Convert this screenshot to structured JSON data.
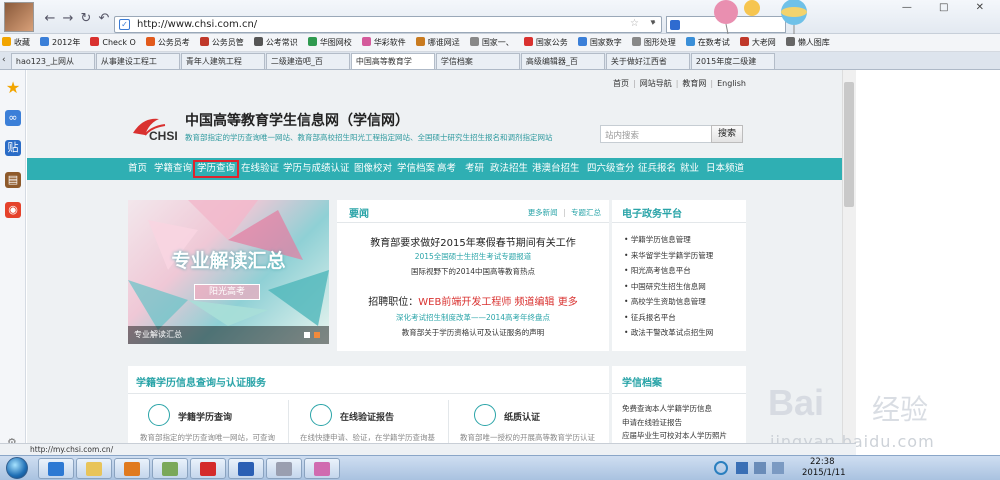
{
  "browser": {
    "url": "http://www.chsi.com.cn/",
    "window_controls": "— □ ✕",
    "favorites": [
      "收藏",
      "2012年",
      "Check O",
      "公务员考",
      "公务员管",
      "公考常识",
      "华图网校",
      "华彩软件",
      "哪谁网迳",
      "国家一、",
      "国家公务",
      "国家数字",
      "图形处理",
      "在数考试",
      "大老网",
      "懒人图库"
    ],
    "tabs": [
      "hao123_上网从",
      "从事建设工程工",
      "青年人建筑工程",
      "二级建造吧_百",
      "中国高等教育学",
      "学信档案",
      "高级编辑器_百",
      "关于做好江西省",
      "2015年度二级建"
    ],
    "active_tab": 4
  },
  "site": {
    "top_links": [
      "首页",
      "网站导航",
      "教育网",
      "English"
    ],
    "logo_text": "CHSI",
    "title": "中国高等教育学生信息网（学信网）",
    "description": "教育部指定的学历查询唯一网站、教育部高校招生阳光工程指定网站、全国硕士研究生招生报名和调剂指定网站",
    "search_placeholder": "站内搜索",
    "search_button": "搜索",
    "nav": [
      "首页",
      "学籍查询",
      "学历查询",
      "在线验证",
      "学历与成绩认证",
      "图像校对",
      "学信档案",
      "高考",
      "考研",
      "政法招生",
      "港澳台招生",
      "四六级查分",
      "征兵报名",
      "就业",
      "日本频道"
    ],
    "highlighted_nav": "学历查询"
  },
  "banner": {
    "title": "专业解读汇总",
    "subtitle": "阳光高考",
    "caption": "专业解读汇总"
  },
  "news": {
    "heading": "要闻",
    "more": "更多新闻",
    "special": "专题汇总",
    "headline1": "教育部要求做好2015年寒假春节期间有关工作",
    "sub1": "2015全国硕士生招生考试专题报道",
    "sub2": "国际视野下的2014中国高等教育热点",
    "headline2_prefix": "招聘职位：",
    "headline2_job": "WEB前端开发工程师",
    "headline2_job2": "频道编辑",
    "headline2_more": "更多",
    "sub3": "深化考试招生制度改革——2014高考年终盘点",
    "sub4": "教育部关于学历资格认可及认证服务的声明"
  },
  "egov": {
    "heading": "电子政务平台",
    "items": [
      "学籍学历信息管理",
      "来华留学生学籍学历管理",
      "阳光高考信息平台",
      "中国研究生招生信息网",
      "高校学生资助信息管理",
      "征兵报名平台",
      "政法干警改革试点招生网"
    ]
  },
  "services": {
    "heading": "学籍学历信息查询与认证服务",
    "items": [
      {
        "title": "学籍学历查询",
        "desc": "教育部指定的学历查询唯一网站，可查询"
      },
      {
        "title": "在线验证报告",
        "desc": "在线快捷申请、验证，在学籍学历查询基"
      },
      {
        "title": "纸质认证",
        "desc": "教育部唯一授权的开展高等教育学历认证"
      }
    ]
  },
  "archive": {
    "heading": "学信档案",
    "items": [
      "免费查询本人学籍学历信息",
      "申请在线验证报告",
      "应届毕业生可校对本人学历照片"
    ]
  },
  "status_bar": "http://my.chsi.com.cn/",
  "taskbar": {
    "time": "22:38",
    "date": "2015/1/11"
  },
  "watermark": {
    "brand": "Bai",
    "brand2": "经验",
    "url": "jingyan.baidu.com"
  },
  "colors": {
    "teal": "#2fafb3",
    "highlight": "#e0242d",
    "link_red": "#d9312f"
  }
}
